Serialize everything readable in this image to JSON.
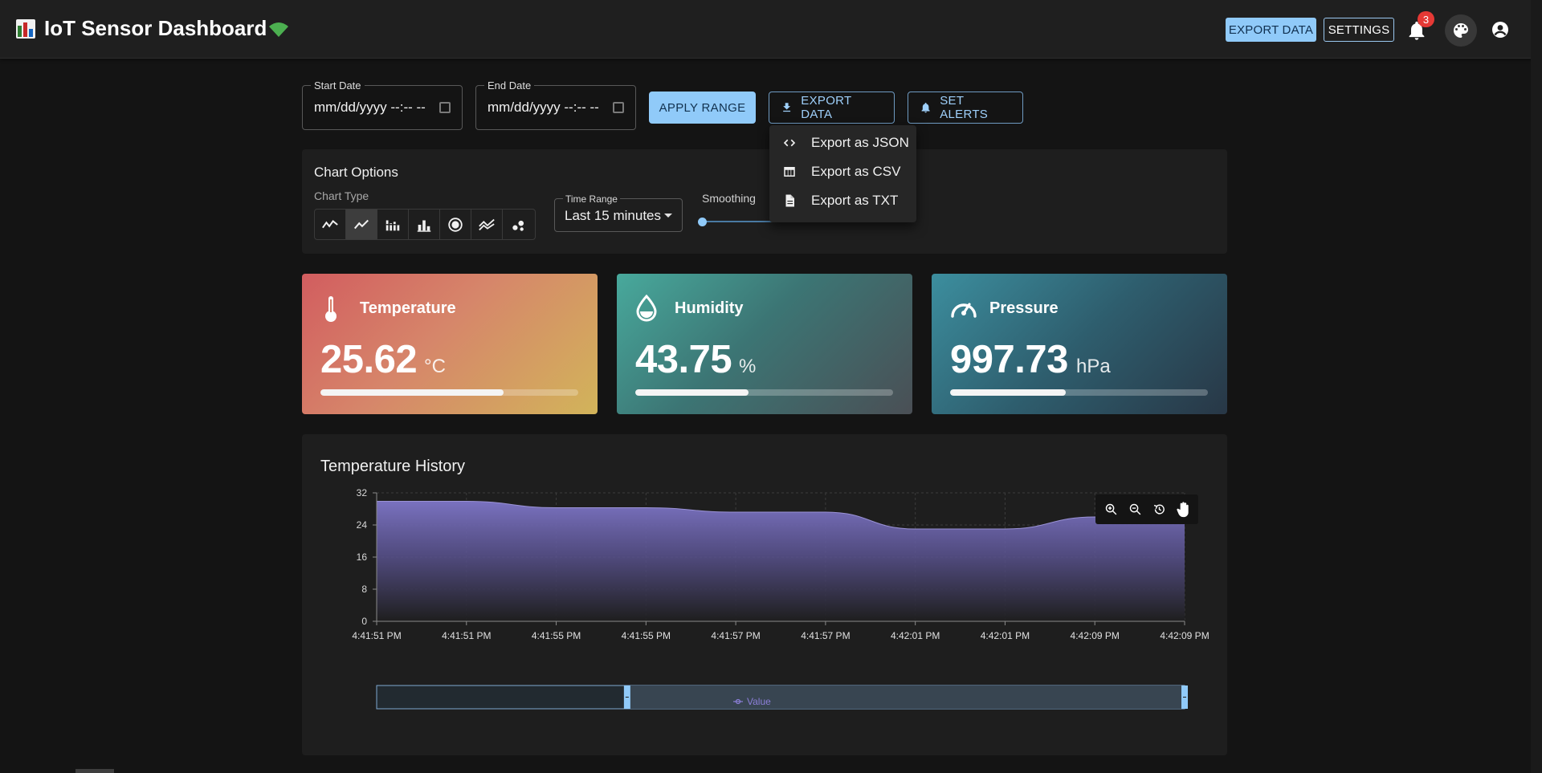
{
  "appbar": {
    "title": "IoT Sensor Dashboard",
    "export_label": "EXPORT DATA",
    "settings_label": "SETTINGS",
    "notification_count": "3",
    "logo_icon": "bar-chart-icon",
    "status_icon": "wifi-icon",
    "accent_color": "#90caf9"
  },
  "filters": {
    "start_date": {
      "label": "Start Date",
      "value": "mm/dd/yyyy  --:-- --"
    },
    "end_date": {
      "label": "End Date",
      "value": "mm/dd/yyyy  --:-- --"
    },
    "apply_label": "APPLY RANGE",
    "export_label": "EXPORT DATA",
    "alerts_label": "SET ALERTS"
  },
  "export_menu": {
    "items": [
      {
        "label": "Export as JSON",
        "icon": "code-icon"
      },
      {
        "label": "Export as CSV",
        "icon": "table-icon"
      },
      {
        "label": "Export as TXT",
        "icon": "file-text-icon"
      }
    ]
  },
  "chart_options": {
    "title": "Chart Options",
    "chart_type_label": "Chart Type",
    "chart_types": [
      "line",
      "area",
      "stacked-bar",
      "bar",
      "radial",
      "multi-line",
      "scatter"
    ],
    "selected_chart_type": "area",
    "time_range_label": "Time Range",
    "time_range_value": "Last 15 minutes",
    "smoothing_label": "Smoothing",
    "smoothing_value": 0
  },
  "metrics": [
    {
      "name": "Temperature",
      "value": "25.62",
      "unit": "°C",
      "icon": "thermometer-icon",
      "level": 0.71
    },
    {
      "name": "Humidity",
      "value": "43.75",
      "unit": "%",
      "icon": "water-drop-icon",
      "level": 0.44
    },
    {
      "name": "Pressure",
      "value": "997.73",
      "unit": "hPa",
      "icon": "speedometer-icon",
      "level": 0.45
    }
  ],
  "history": {
    "title": "Temperature History",
    "slider_label": "Value",
    "toolbar_icons": [
      "zoom-in-icon",
      "zoom-out-icon",
      "reset-icon",
      "pan-icon"
    ]
  },
  "chart_data": {
    "type": "area",
    "title": "Temperature History",
    "categories": [
      "4:41:51 PM",
      "4:41:51 PM",
      "4:41:55 PM",
      "4:41:55 PM",
      "4:41:57 PM",
      "4:41:57 PM",
      "4:42:01 PM",
      "4:42:01 PM",
      "4:42:09 PM",
      "4:42:09 PM"
    ],
    "series": [
      {
        "values": [
          29.9,
          29.9,
          28.3,
          28.3,
          27.2,
          27.2,
          23.0,
          23.0,
          26.0,
          26.0
        ]
      }
    ],
    "ylim": [
      0,
      32
    ],
    "yticks": [
      0,
      8,
      16,
      24,
      32
    ],
    "grid": true,
    "color": "#7a72c0"
  }
}
